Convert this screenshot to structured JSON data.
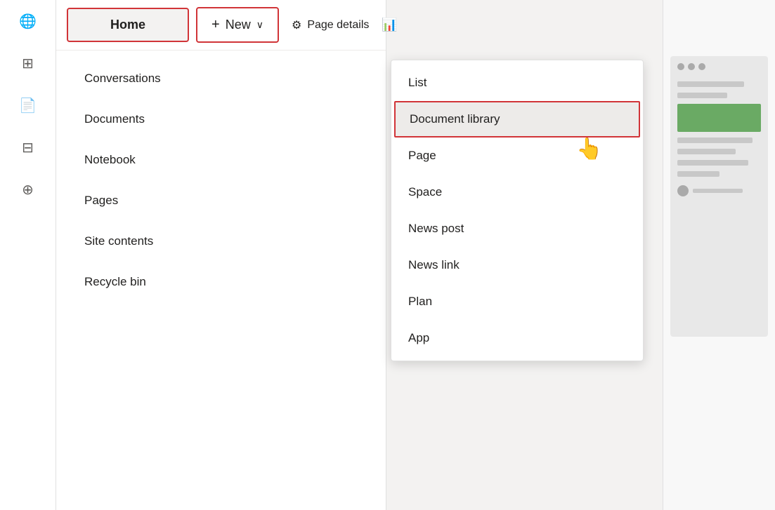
{
  "sidebar": {
    "icons": [
      {
        "name": "globe-icon",
        "symbol": "🌐"
      },
      {
        "name": "grid-icon",
        "symbol": "⊞"
      },
      {
        "name": "document-icon",
        "symbol": "📄"
      },
      {
        "name": "table-icon",
        "symbol": "⊟"
      },
      {
        "name": "add-icon",
        "symbol": "⊕"
      }
    ]
  },
  "header": {
    "home_label": "Home",
    "new_label": "New",
    "page_details_label": "Page details",
    "gear_symbol": "⚙",
    "plus_symbol": "+",
    "chevron_symbol": "∨",
    "analytics_symbol": "📊"
  },
  "nav": {
    "items": [
      {
        "label": "Conversations"
      },
      {
        "label": "Documents"
      },
      {
        "label": "Notebook"
      },
      {
        "label": "Pages"
      },
      {
        "label": "Site contents"
      },
      {
        "label": "Recycle bin"
      }
    ]
  },
  "dropdown": {
    "items": [
      {
        "label": "List",
        "highlighted": false
      },
      {
        "label": "Document library",
        "highlighted": true
      },
      {
        "label": "Page",
        "highlighted": false
      },
      {
        "label": "Space",
        "highlighted": false
      },
      {
        "label": "News post",
        "highlighted": false
      },
      {
        "label": "News link",
        "highlighted": false
      },
      {
        "label": "Plan",
        "highlighted": false
      },
      {
        "label": "App",
        "highlighted": false
      }
    ]
  },
  "preview": {
    "dots": 3,
    "lines": [
      30,
      60,
      80,
      50,
      70
    ]
  }
}
